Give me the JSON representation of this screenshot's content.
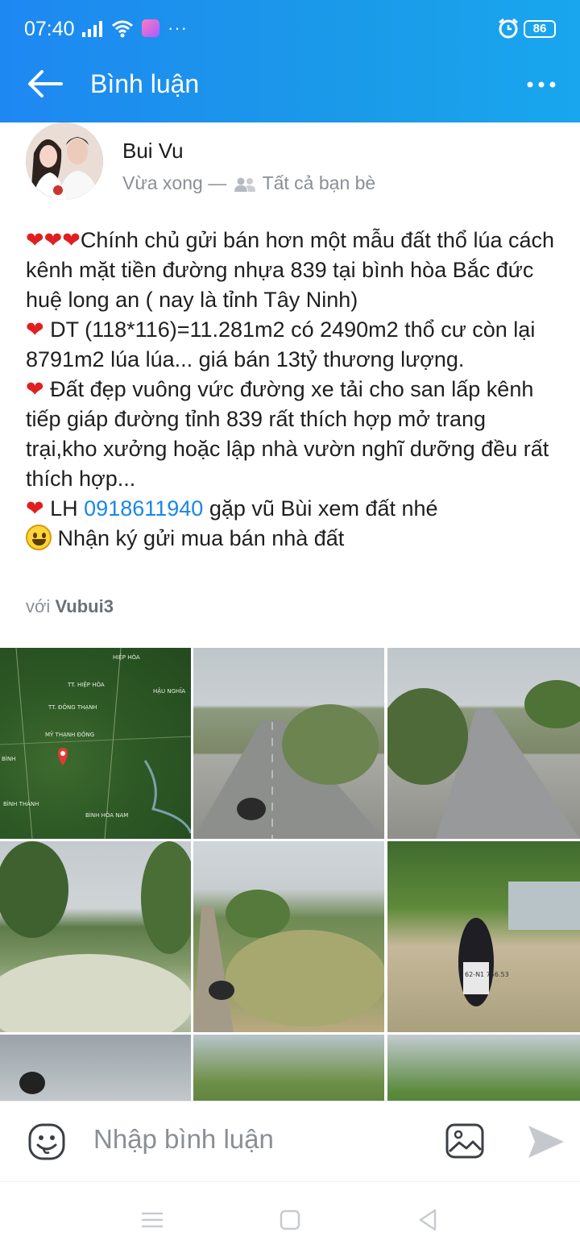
{
  "status_bar": {
    "time": "07:40",
    "dots": "···",
    "battery": "86"
  },
  "app_bar": {
    "title": "Bình luận"
  },
  "post": {
    "author": "Bui Vu",
    "time": "Vừa xong",
    "separator": "—",
    "audience": "Tất cả bạn bè",
    "lines": {
      "l1": "Chính chủ gửi bán hơn một mẫu đất thổ lúa cách kênh mặt tiền đường nhựa 839 tại bình hòa Bắc đức huệ long an ( nay là tỉnh Tây Ninh)",
      "l2": " DT (118*116)=11.281m2 có 2490m2 thổ cư còn lại 8791m2 lúa lúa... giá bán 13tỷ thương lượng.",
      "l3": " Đất đẹp vuông vức đường xe tải cho san lấp kênh tiếp giáp đường tỉnh 839 rất thích hợp mở trang trại,kho xưởng hoặc lập nhà vườn nghĩ dưỡng đều rất thích hợp...",
      "l4_prefix": " LH ",
      "l4_phone": "0918611940",
      "l4_suffix": " gặp vũ Bùi xem đất nhé",
      "l5": " Nhận ký gửi mua bán nhà đất"
    },
    "hearts_triple": "❤❤❤",
    "heart": "❤",
    "with_prefix": "với ",
    "with_name": "Vubui3",
    "map_labels": [
      "HIỆP HÒA",
      "TT. HIỆP HÒA",
      "HẬU NGHĨA",
      "TT. ĐÔNG THẠNH",
      "MỸ THẠNH ĐÔNG",
      "BÌNH",
      "BÌNH THÀNH",
      "BÌNH HÒA NAM"
    ],
    "plate": "62-N1 756.53"
  },
  "composer": {
    "placeholder": "Nhập bình luận"
  },
  "colors": {
    "accent": "#1a87e6",
    "heart": "#e02020"
  }
}
